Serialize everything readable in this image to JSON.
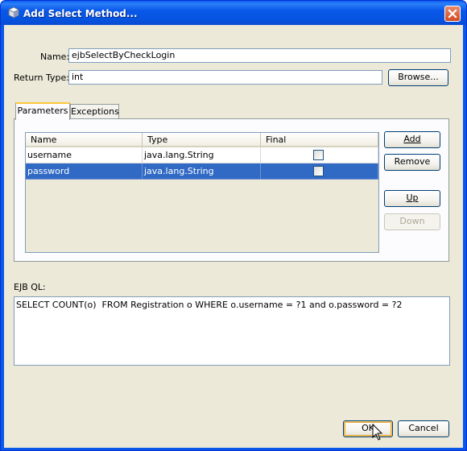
{
  "window": {
    "title": "Add Select Method..."
  },
  "form": {
    "name_label": "Name:",
    "name_value": "ejbSelectByCheckLogin",
    "return_type_label": "Return Type:",
    "return_type_value": "int",
    "browse_label": "Browse..."
  },
  "tabs": [
    {
      "label": "Parameters",
      "active": true
    },
    {
      "label": "Exceptions",
      "active": false
    }
  ],
  "table": {
    "columns": [
      "Name",
      "Type",
      "Final"
    ],
    "rows": [
      {
        "name": "username",
        "type": "java.lang.String",
        "final": false,
        "selected": false
      },
      {
        "name": "password",
        "type": "java.lang.String",
        "final": false,
        "selected": true
      }
    ]
  },
  "side_buttons": {
    "add": "Add",
    "remove": "Remove",
    "up": "Up",
    "down": "Down"
  },
  "ejbql": {
    "label": "EJB QL:",
    "query": "SELECT COUNT(o)  FROM Registration o WHERE o.username = ?1 and o.password = ?2"
  },
  "footer": {
    "ok": "OK",
    "cancel": "Cancel"
  }
}
